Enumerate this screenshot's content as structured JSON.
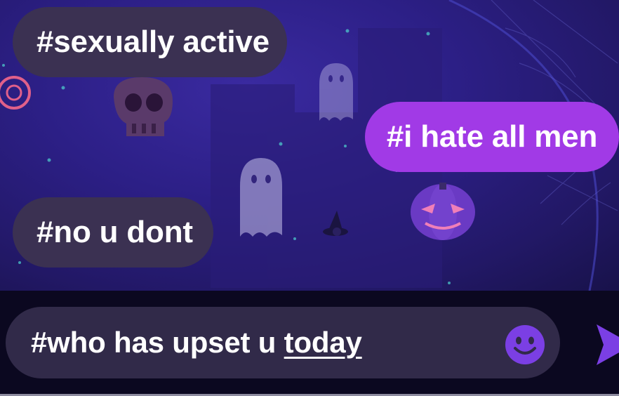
{
  "messages": [
    {
      "direction": "incoming",
      "text": "#sexually active"
    },
    {
      "direction": "outgoing",
      "text": "#i hate all men"
    },
    {
      "direction": "incoming",
      "text": "#no u dont"
    }
  ],
  "composer": {
    "text_before": "#who has upset u ",
    "text_underlined": "today",
    "emoji_icon": "smiley-face-icon",
    "send_icon": "send-arrow-icon"
  },
  "theme": {
    "incoming_bubble": "#3b3152",
    "outgoing_bubble": "#a13ae6",
    "accent": "#7b3fe4",
    "input_background": "#312a49",
    "background": "#2c1f86"
  }
}
